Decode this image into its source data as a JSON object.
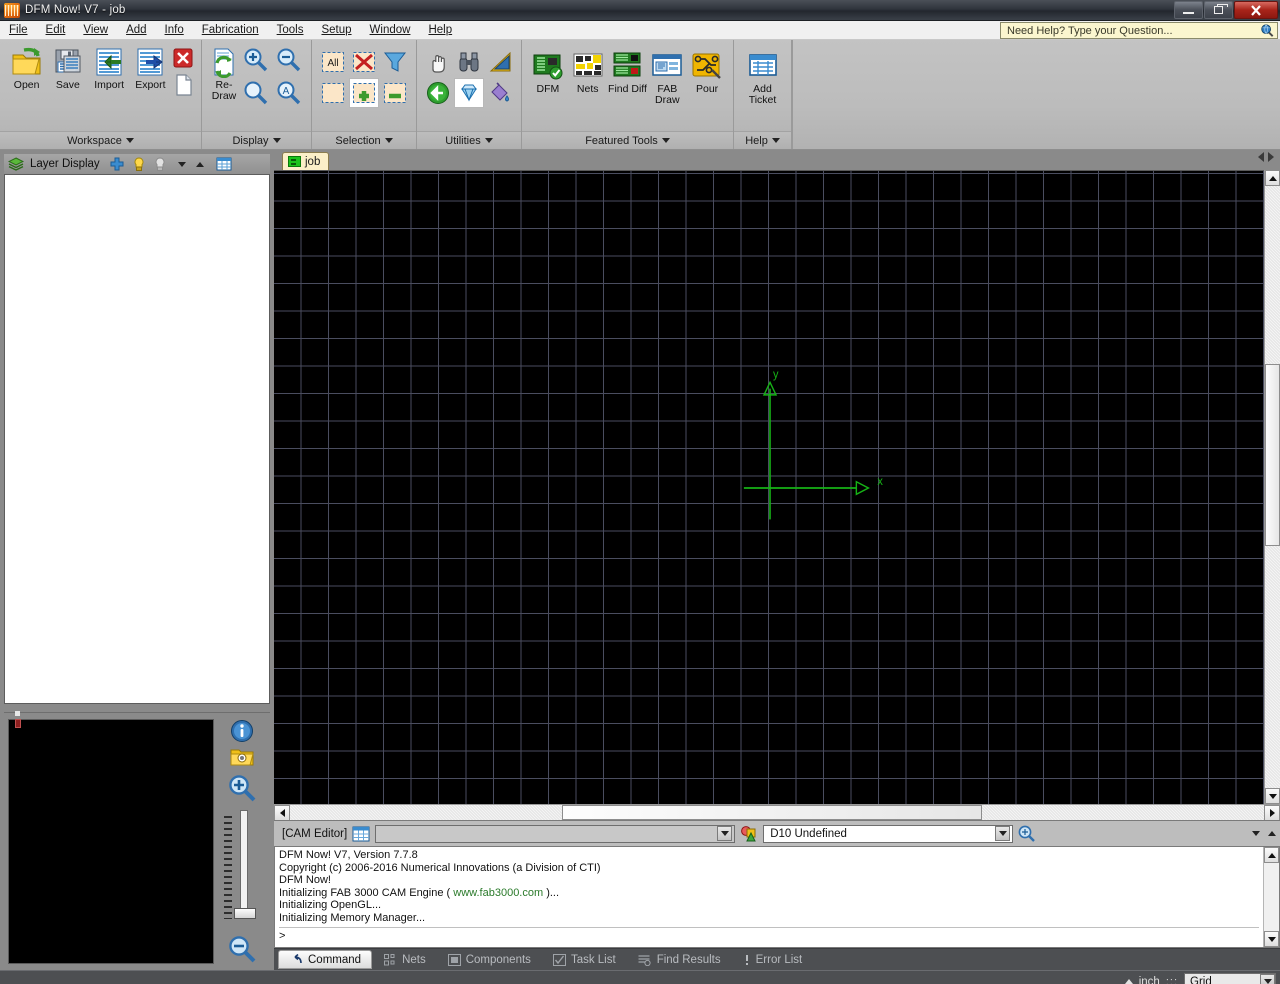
{
  "window": {
    "title": "DFM Now! V7 - job",
    "app_icon": "flame-icon",
    "minimize_label": "Minimize",
    "maximize_label": "Maximize",
    "close_label": "Close"
  },
  "menubar": {
    "items": [
      {
        "label": "File",
        "mnemonic": "F"
      },
      {
        "label": "Edit",
        "mnemonic": "E"
      },
      {
        "label": "View",
        "mnemonic": "V"
      },
      {
        "label": "Add",
        "mnemonic": "A"
      },
      {
        "label": "Info",
        "mnemonic": "I"
      },
      {
        "label": "Fabrication",
        "mnemonic": "F"
      },
      {
        "label": "Tools",
        "mnemonic": "T"
      },
      {
        "label": "Setup",
        "mnemonic": "S"
      },
      {
        "label": "Window",
        "mnemonic": "W"
      },
      {
        "label": "Help",
        "mnemonic": "H"
      }
    ],
    "help_search_placeholder": "Need Help? Type your Question...",
    "help_search_value": "Need Help? Type your Question..."
  },
  "ribbon": {
    "groups": [
      {
        "label": "Workspace",
        "buttons": [
          {
            "label": "Open",
            "icon": "open-folder-icon"
          },
          {
            "label": "Save",
            "icon": "save-disk-icon"
          },
          {
            "label": "Import",
            "icon": "import-icon"
          },
          {
            "label": "Export",
            "icon": "export-icon"
          }
        ],
        "small_buttons": [
          {
            "label": "Close",
            "icon": "close-red-x-icon"
          },
          {
            "label": "New File",
            "icon": "new-file-icon"
          }
        ]
      },
      {
        "label": "Display",
        "buttons": [
          {
            "label": "Re-Draw",
            "icon": "redraw-icon"
          }
        ],
        "small_buttons": [
          {
            "label": "Zoom In",
            "icon": "zoom-in-icon"
          },
          {
            "label": "Zoom Out",
            "icon": "zoom-out-icon"
          },
          {
            "label": "Zoom Window",
            "icon": "zoom-window-icon"
          },
          {
            "label": "Zoom All",
            "icon": "zoom-all-icon"
          }
        ]
      },
      {
        "label": "Selection",
        "small_buttons": [
          {
            "label": "Select All",
            "icon": "select-all-icon"
          },
          {
            "label": "Deselect All",
            "icon": "deselect-all-icon"
          },
          {
            "label": "Filter",
            "icon": "funnel-filter-icon"
          },
          {
            "label": "Select Window",
            "icon": "select-window-icon"
          },
          {
            "label": "Add To Selection",
            "icon": "select-add-icon"
          },
          {
            "label": "Remove From Selection",
            "icon": "select-remove-icon"
          }
        ]
      },
      {
        "label": "Utilities",
        "small_buttons": [
          {
            "label": "Pan",
            "icon": "hand-pan-icon"
          },
          {
            "label": "Find",
            "icon": "binoculars-find-icon"
          },
          {
            "label": "Measure",
            "icon": "ruler-measure-icon"
          },
          {
            "label": "Back",
            "icon": "back-arrow-icon"
          },
          {
            "label": "Gem Tool",
            "icon": "diamond-gem-icon"
          },
          {
            "label": "Fill",
            "icon": "paint-bucket-icon"
          }
        ]
      },
      {
        "label": "Featured Tools",
        "buttons": [
          {
            "label": "DFM",
            "icon": "dfm-board-icon"
          },
          {
            "label": "Nets",
            "icon": "nets-icon"
          },
          {
            "label": "Find Diff",
            "icon": "find-diff-icon"
          },
          {
            "label": "FAB Draw",
            "icon": "fab-draw-icon"
          },
          {
            "label": "Pour",
            "icon": "pour-icon"
          }
        ]
      },
      {
        "label": "Help",
        "buttons": [
          {
            "label": "Add Ticket",
            "icon": "add-ticket-icon"
          }
        ]
      }
    ]
  },
  "left_panel": {
    "title": "Layer Display",
    "header_icon": "layers-icon",
    "toolbar_icons": [
      {
        "name": "add-layer-icon",
        "label": "Add Layer"
      },
      {
        "name": "bulb-on-icon",
        "label": "Show Layer"
      },
      {
        "name": "bulb-off-icon",
        "label": "Hide Layer"
      },
      {
        "name": "move-down-icon",
        "label": "Move Down"
      },
      {
        "name": "move-up-icon",
        "label": "Move Up"
      },
      {
        "name": "layer-table-icon",
        "label": "Layer Table"
      }
    ],
    "layers": []
  },
  "preview_panel": {
    "info_icon": "info-icon",
    "open_icon": "open-preview-icon",
    "zoom_in_icon": "zoom-in-icon",
    "zoom_out_icon": "zoom-out-icon",
    "zoom_slider_label": "Zoom Level"
  },
  "tabs": {
    "items": [
      {
        "label": "job",
        "icon": "board-tab-icon",
        "active": true
      }
    ],
    "nav_prev": "previous-tab",
    "nav_next": "next-tab"
  },
  "canvas": {
    "axis_x_label": "x",
    "axis_y_label": "y",
    "background": "#000000",
    "grid_color": "#585b70",
    "axis_color": "#16b316"
  },
  "cam_bar": {
    "label": "[CAM Editor]",
    "table_icon": "cam-table-icon",
    "layer_combo_value": "",
    "layer_combo_placeholder": "",
    "shape_icon": "shapes-icon",
    "aperture_combo_value": "D10 Undefined",
    "aperture_icon": "aperture-icon",
    "collapse_icon": "collapse-down-icon",
    "expand_icon": "expand-up-icon"
  },
  "console": {
    "lines": [
      "DFM Now! V7,  Version 7.7.8",
      "Copyright (c) 2006-2016  Numerical Innovations (a Division of CTI)",
      "DFM Now!",
      "Initializing FAB 3000 CAM Engine ( www.fab3000.com )...",
      "Initializing OpenGL...",
      "Initializing Memory Manager..."
    ],
    "link_text": "www.fab3000.com",
    "prompt": ">"
  },
  "bottom_tabs": {
    "items": [
      {
        "label": "Command",
        "icon": "command-arrow-icon",
        "active": true
      },
      {
        "label": "Nets",
        "icon": "nets-small-icon",
        "active": false
      },
      {
        "label": "Components",
        "icon": "components-icon",
        "active": false
      },
      {
        "label": "Task List",
        "icon": "task-list-icon",
        "active": false
      },
      {
        "label": "Find Results",
        "icon": "find-results-icon",
        "active": false
      },
      {
        "label": "Error List",
        "icon": "error-list-icon",
        "active": false
      }
    ]
  },
  "statusbar": {
    "unit_toggle_icon": "up-triangle-icon",
    "unit": "inch",
    "separator": ":::",
    "snap_mode": "Grid"
  },
  "colors": {
    "accent_green": "#16b316",
    "tab_yellow": "#fbefc8",
    "canvas_black": "#000000",
    "ribbon_gray": "#bcbcbc",
    "dock_gray": "#8a8a8a",
    "statusbar_dark": "#4d4f52",
    "help_yellow": "#fbf6cf"
  }
}
